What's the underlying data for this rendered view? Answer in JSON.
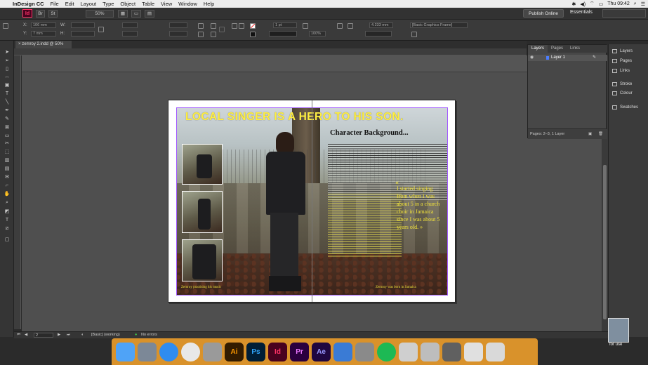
{
  "menubar": {
    "app_name": "InDesign CC",
    "items": [
      "File",
      "Edit",
      "Layout",
      "Type",
      "Object",
      "Table",
      "View",
      "Window",
      "Help"
    ],
    "clock": "Thu 09:42",
    "status_icons": [
      "bluetooth-icon",
      "volume-icon",
      "wifi-icon",
      "battery-icon",
      "search-icon",
      "list-icon"
    ]
  },
  "appbar": {
    "logo": "Id",
    "bridge_btn": "Br",
    "stock_btn": "St",
    "zoom": "50%",
    "publish": "Publish Online",
    "workspace": "Essentials",
    "search_placeholder": ""
  },
  "control": {
    "x_label": "X:",
    "y_label": "Y:",
    "w_label": "W:",
    "h_label": "H:",
    "x_value": "106 mm",
    "y_value": "7 mm",
    "stroke_weight": "1 pt",
    "size_value": "4.233 mm",
    "opacity": "100%",
    "frame_style": "[Basic Graphics Frame]"
  },
  "document": {
    "tab_title": "zemroy 2.indd @ 50%"
  },
  "spread": {
    "headline": "LOCAL SINGER IS A HERO TO HIS SON.",
    "subheading": "Character Background...",
    "quote_open": "«",
    "quote": "I started singing from when I was about 5 in a church choir in Jamaica since I was about 5 years old.",
    "quote_close": "»",
    "caption_left": "Zemroy practising his music",
    "caption_right": "Zemroy was born in Jamaica"
  },
  "layers_panel": {
    "tabs": [
      "Layers",
      "Pages",
      "Links"
    ],
    "layer_name": "Layer 1",
    "footer": "Pages: 2–3, 1 Layer"
  },
  "side_panels": [
    "Layers",
    "Pages",
    "Links",
    "Stroke",
    "Colour",
    "Swatches"
  ],
  "statusbar": {
    "page": "2",
    "style": "[Basic] (working)",
    "errors": "No errors"
  },
  "dock": {
    "apps": [
      {
        "name": "finder-icon",
        "label": "",
        "color": "#4fa3f7"
      },
      {
        "name": "launchpad-icon",
        "label": "",
        "color": "#7c8897"
      },
      {
        "name": "safari-icon",
        "label": "",
        "color": "#2f8cf0"
      },
      {
        "name": "chrome-icon",
        "label": "",
        "color": "#e8e8e8"
      },
      {
        "name": "screenshot-icon",
        "label": "",
        "color": "#9a9a9a"
      },
      {
        "name": "illustrator-icon",
        "label": "Ai",
        "color": "#331c00"
      },
      {
        "name": "photoshop-icon",
        "label": "Ps",
        "color": "#001e36"
      },
      {
        "name": "indesign-icon",
        "label": "Id",
        "color": "#49021f"
      },
      {
        "name": "premiere-icon",
        "label": "Pr",
        "color": "#2a003f"
      },
      {
        "name": "aftereffects-icon",
        "label": "Ae",
        "color": "#1f0740"
      },
      {
        "name": "keynote-icon",
        "label": "",
        "color": "#3a7bd5"
      },
      {
        "name": "system-preferences-icon",
        "label": "",
        "color": "#8a8a8a"
      },
      {
        "name": "spotify-icon",
        "label": "",
        "color": "#1db954"
      },
      {
        "name": "photo-doc-icon",
        "label": "",
        "color": "#cfcfcf"
      },
      {
        "name": "preview-icon",
        "label": "",
        "color": "#bdbdbd"
      },
      {
        "name": "image-doc-icon",
        "label": "",
        "color": "#606060"
      },
      {
        "name": "calculator-icon",
        "label": "",
        "color": "#e0e0e0"
      },
      {
        "name": "trash-icon",
        "label": "",
        "color": "#d9d9d9"
      }
    ]
  },
  "desktop_file": "for use"
}
